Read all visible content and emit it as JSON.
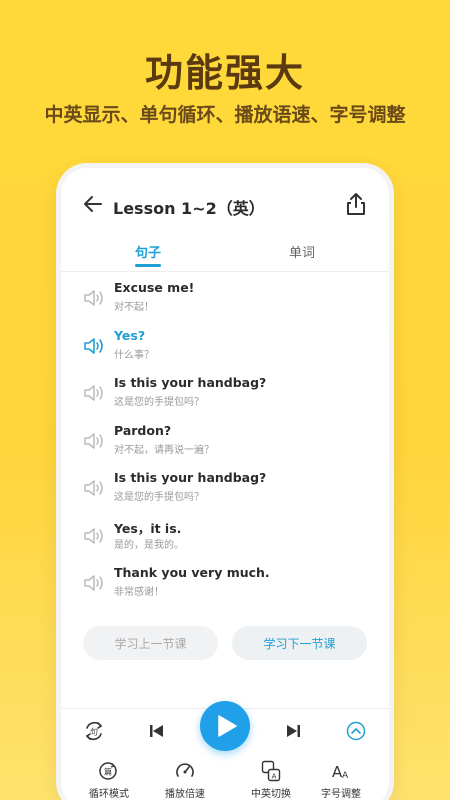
{
  "hero": {
    "title": "功能强大",
    "subtitle": "中英显示、单句循环、播放语速、字号调整"
  },
  "header": {
    "title": "Lesson 1~2（英）"
  },
  "tabs": {
    "sentences": "句子",
    "words": "单词"
  },
  "sentences": [
    {
      "en": "Excuse me!",
      "zh": "对不起！"
    },
    {
      "en": "Yes?",
      "zh": "什么事？"
    },
    {
      "en": "Is this your handbag?",
      "zh": "这是您的手提包吗？"
    },
    {
      "en": "Pardon?",
      "zh": "对不起，请再说一遍？"
    },
    {
      "en": "Is this your handbag?",
      "zh": "这是您的手提包吗？"
    },
    {
      "en": "Yes，it is.",
      "zh": "是的，是我的。"
    },
    {
      "en": "Thank you very much.",
      "zh": "非常感谢！"
    }
  ],
  "buttons": {
    "prev_lesson": "学习上一节课",
    "next_lesson": "学习下一节课"
  },
  "player": {
    "loop_mode": "循环模式",
    "speed": "播放倍速",
    "lang_switch": "中英切换",
    "font_size": "字号调整",
    "repeat_glyph": "句",
    "loop_glyph": "篇"
  },
  "colors": {
    "accent": "#1fa0d4",
    "background": "#ffd93a",
    "hero_text": "#5b3a12"
  }
}
